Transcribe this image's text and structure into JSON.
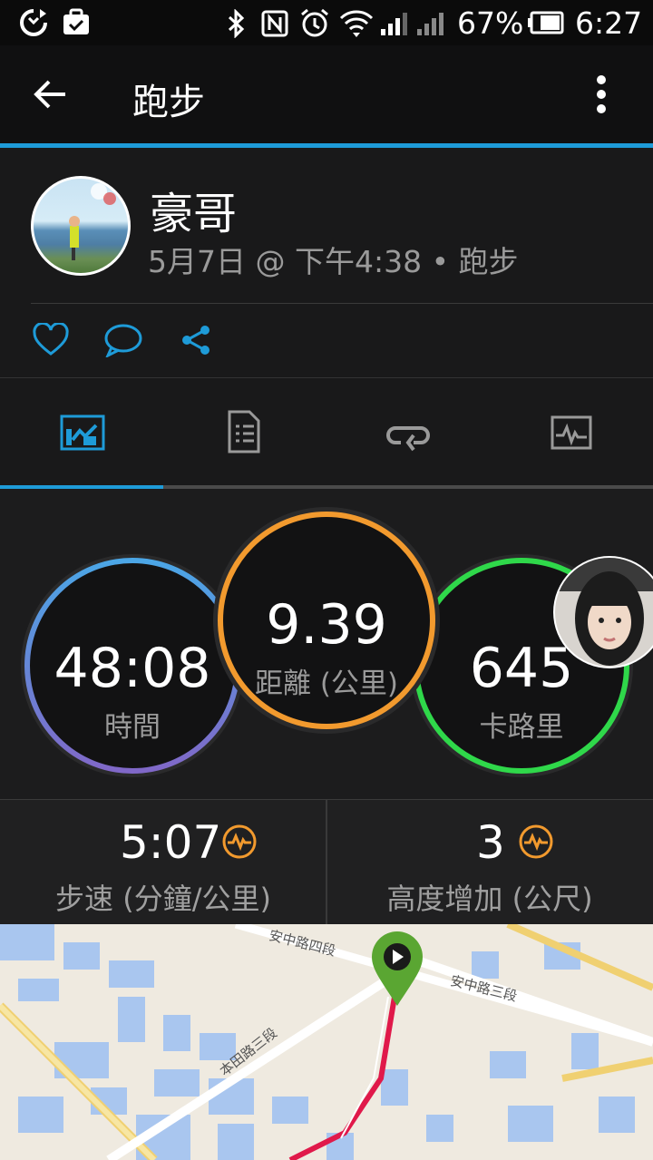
{
  "status_bar": {
    "battery_percent": "67%",
    "time": "6:27"
  },
  "app_bar": {
    "title": "跑步"
  },
  "profile": {
    "name": "豪哥",
    "meta": "5月7日 @ 下午4:38 • 跑步"
  },
  "stats": {
    "time_value": "48:08",
    "time_label": "時間",
    "distance_value": "9.39",
    "distance_label": "距離 (公里)",
    "calories_value": "645",
    "calories_label": "卡路里",
    "pace_value": "5:07",
    "pace_label": "步速 (分鐘/公里)",
    "elevation_value": "3",
    "elevation_label": "高度增加 (公尺)"
  },
  "tabs": {
    "active_index": 0,
    "icons": [
      "overview-chart-icon",
      "details-list-icon",
      "laps-loop-icon",
      "graph-icon"
    ]
  },
  "map": {
    "road_1": "安中路四段",
    "road_2": "安中路三段",
    "road_3": "本田路三段"
  },
  "colors": {
    "accent_blue": "#1e9bd8",
    "time_ring": "#5aa6e6",
    "distance_ring": "#f29a2e",
    "calories_ring": "#2fd84a",
    "route": "#e0194a",
    "start_pin": "#5aa632"
  }
}
